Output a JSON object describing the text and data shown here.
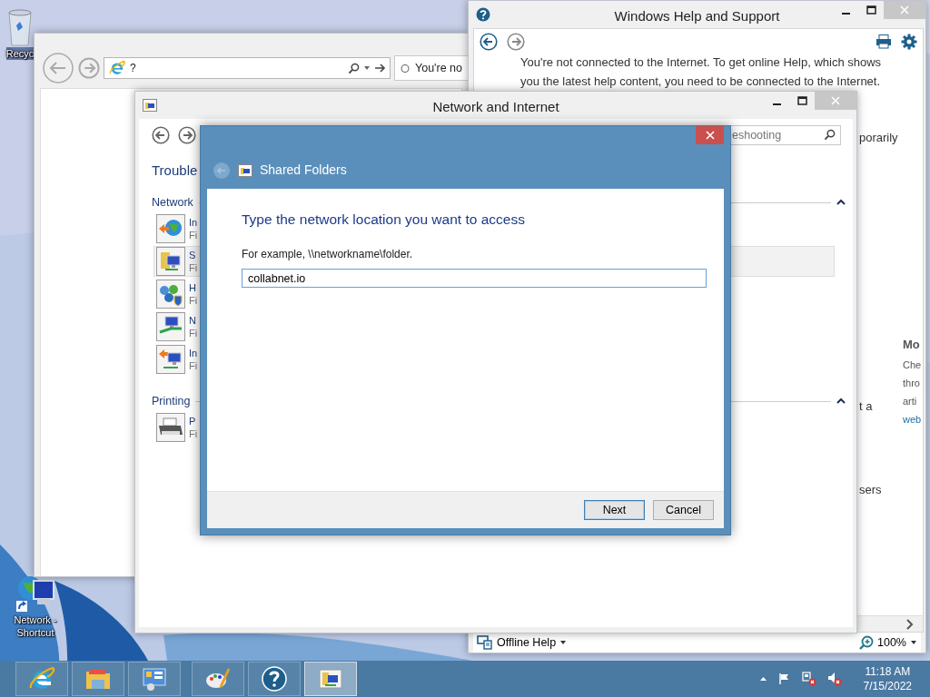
{
  "desktop": {
    "icons": [
      {
        "kind": "recycle-bin",
        "label": "Recyc"
      },
      {
        "kind": "network",
        "label": "Network - Shortcut"
      }
    ]
  },
  "browser": {
    "address": "?",
    "tab": "You're no"
  },
  "help": {
    "title": "Windows Help and Support",
    "message": "You're not connected to the Internet. To get online Help, which shows you the latest help content, you need to be connected to the Internet.",
    "fragments": [
      "porarily",
      "t a",
      "sers"
    ],
    "side": {
      "heading": "Mo",
      "lines": [
        "Che",
        "thro",
        "arti"
      ],
      "link": "web"
    },
    "source": "Offline Help",
    "zoom": "100%"
  },
  "control_panel": {
    "title": "Network and Internet",
    "search_placeholder": "eshooting",
    "heading": "Trouble",
    "groups": [
      {
        "label": "Network",
        "expanded": true,
        "items": [
          {
            "kind": "internet",
            "title": "In",
            "subtitle": "Fi",
            "selected": false
          },
          {
            "kind": "shared",
            "title": "S",
            "subtitle": "Fi",
            "selected": true
          },
          {
            "kind": "homegroup",
            "title": "H",
            "subtitle": "Fi",
            "selected": false
          },
          {
            "kind": "adapter",
            "title": "N",
            "subtitle": "Fi",
            "selected": false
          },
          {
            "kind": "incoming",
            "title": "In",
            "subtitle": "Fi",
            "selected": false
          }
        ]
      },
      {
        "label": "Printing",
        "expanded": true,
        "items": [
          {
            "kind": "printer",
            "title": "P",
            "subtitle": "Fi",
            "selected": false
          }
        ]
      }
    ]
  },
  "dialog": {
    "title": "Shared Folders",
    "heading": "Type the network location you want to access",
    "hint": "For example, \\\\networkname\\folder.",
    "value": "collabnet.io",
    "buttons": [
      {
        "label": "Next",
        "default": true
      },
      {
        "label": "Cancel",
        "default": false
      }
    ]
  },
  "taskbar": {
    "apps": [
      {
        "kind": "ie",
        "active": false
      },
      {
        "kind": "explorer",
        "active": false
      },
      {
        "kind": "control-panel",
        "active": false
      },
      {
        "kind": "paint",
        "active": false
      },
      {
        "kind": "help",
        "active": false
      },
      {
        "kind": "shared-folders",
        "active": true
      }
    ],
    "clock": {
      "time": "11:18 AM",
      "date": "7/15/2022"
    }
  }
}
